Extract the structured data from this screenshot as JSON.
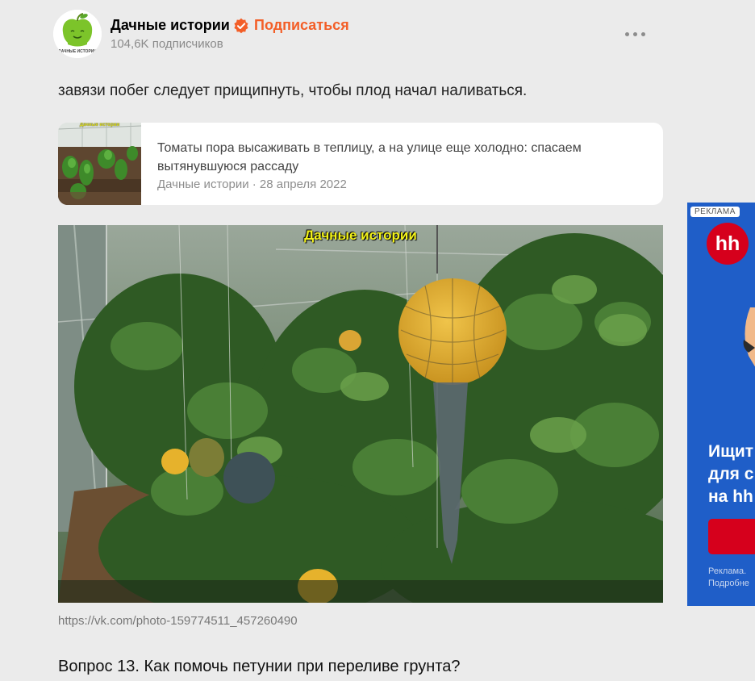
{
  "channel": {
    "name": "Дачные истории",
    "subscribe_label": "Подписаться",
    "subscribers": "104,6K подписчиков",
    "avatar_caption": "ДАЧНЫЕ ИСТОРИИ",
    "accent_color": "#f35e27"
  },
  "article": {
    "paragraph": "завязи побег следует прищипнуть, чтобы плод начал наливаться.",
    "link_card": {
      "title": "Томаты пора высаживать в теплицу, а на улице еще холодно: спасаем вытянувшуюся рассаду",
      "meta": "Дачные истории · 28 апреля 2022",
      "thumb_watermark": "Дачные истории"
    },
    "photo": {
      "watermark": "Дачные истории"
    },
    "source_link": "https://vk.com/photo-159774511_457260490",
    "question": "Вопрос 13. Как помочь петунии при переливе грунта?"
  },
  "ad": {
    "label": "РЕКЛАМА",
    "logo": "hh",
    "headline_lines": [
      "Ищит",
      "для с",
      "на hh"
    ],
    "small_lines": [
      "Реклама.",
      "Подробне"
    ],
    "brand_color": "#d6001c",
    "bg_color": "#1f5ec8"
  },
  "icons": [
    "verified-badge-icon",
    "more-dots-icon"
  ]
}
